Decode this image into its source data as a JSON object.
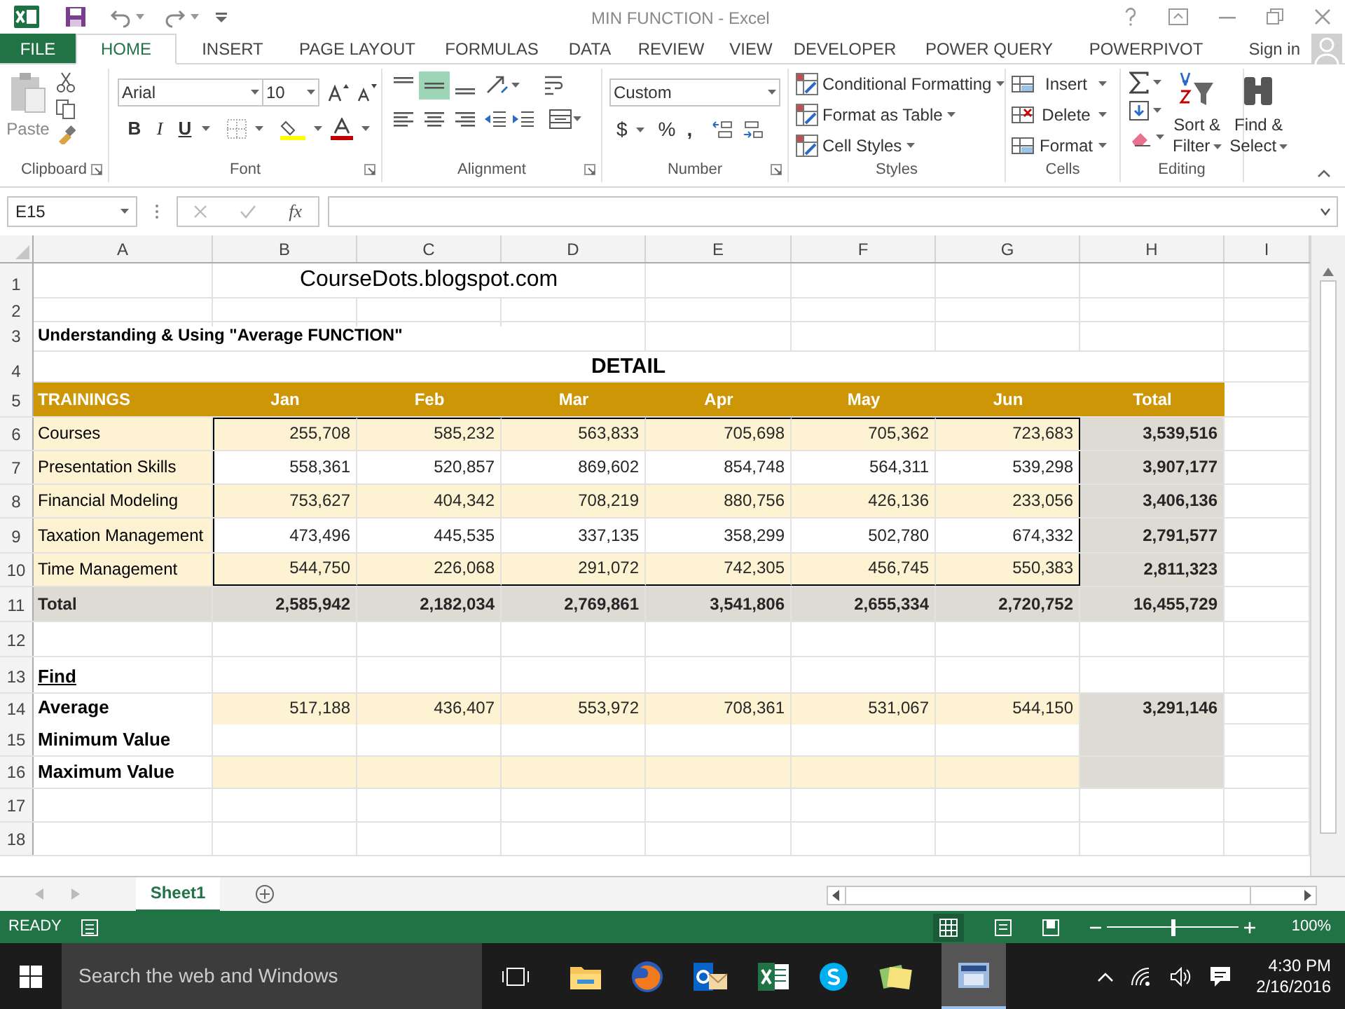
{
  "title_bar": {
    "title": "MIN FUNCTION - Excel"
  },
  "ribbon_tabs": [
    {
      "label": "FILE",
      "kind": "file",
      "selected": false
    },
    {
      "label": "HOME",
      "kind": "tab",
      "selected": true
    },
    {
      "label": "INSERT",
      "kind": "tab",
      "selected": false
    },
    {
      "label": "PAGE LAYOUT",
      "kind": "tab",
      "selected": false
    },
    {
      "label": "FORMULAS",
      "kind": "tab",
      "selected": false
    },
    {
      "label": "DATA",
      "kind": "tab",
      "selected": false
    },
    {
      "label": "REVIEW",
      "kind": "tab",
      "selected": false
    },
    {
      "label": "VIEW",
      "kind": "tab",
      "selected": false
    },
    {
      "label": "DEVELOPER",
      "kind": "tab",
      "selected": false
    },
    {
      "label": "POWER QUERY",
      "kind": "tab",
      "selected": false
    },
    {
      "label": "POWERPIVOT",
      "kind": "tab",
      "selected": false
    }
  ],
  "sign_in": "Sign in",
  "ribbon": {
    "paste": "Paste",
    "font_name": "Arial",
    "font_size": "10",
    "bold": "B",
    "italic": "I",
    "underline": "U",
    "number_format": "Custom",
    "currency": "$",
    "percent": "%",
    "comma": ",",
    "styles_items": [
      "Conditional Formatting",
      "Format as Table",
      "Cell Styles"
    ],
    "cells_items": [
      "Insert",
      "Delete",
      "Format"
    ],
    "sort_filter": [
      "Sort &",
      "Filter"
    ],
    "find_select": [
      "Find &",
      "Select"
    ],
    "groups": [
      "Clipboard",
      "Font",
      "Alignment",
      "Number",
      "Styles",
      "Cells",
      "Editing"
    ]
  },
  "formula_bar": {
    "name_box": "E15",
    "fx": "fx"
  },
  "columns": [
    "A",
    "B",
    "C",
    "D",
    "E",
    "F",
    "G",
    "H",
    "I"
  ],
  "rows": [
    {
      "number": "1",
      "kind": "site",
      "text": "CourseDots.blogspot.com"
    },
    {
      "number": "2",
      "kind": "blank"
    },
    {
      "number": "3",
      "kind": "heading",
      "label": "Understanding & Using \"Average FUNCTION\""
    },
    {
      "number": "4",
      "kind": "detail",
      "title": "DETAIL"
    },
    {
      "number": "5",
      "kind": "header",
      "label": "TRAININGS",
      "values": [
        "Jan",
        "Feb",
        "Mar",
        "Apr",
        "May",
        "Jun"
      ],
      "total": "Total"
    },
    {
      "number": "6",
      "kind": "data",
      "banded": true,
      "label": "Courses",
      "values": [
        "255,708",
        "585,232",
        "563,833",
        "705,698",
        "705,362",
        "723,683"
      ],
      "total": "3,539,516"
    },
    {
      "number": "7",
      "kind": "data",
      "banded": false,
      "label": "Presentation Skills",
      "values": [
        "558,361",
        "520,857",
        "869,602",
        "854,748",
        "564,311",
        "539,298"
      ],
      "total": "3,907,177"
    },
    {
      "number": "8",
      "kind": "data",
      "banded": true,
      "label": "Financial Modeling",
      "values": [
        "753,627",
        "404,342",
        "708,219",
        "880,756",
        "426,136",
        "233,056"
      ],
      "total": "3,406,136"
    },
    {
      "number": "9",
      "kind": "data",
      "banded": false,
      "label": "Taxation Management",
      "values": [
        "473,496",
        "445,535",
        "337,135",
        "358,299",
        "502,780",
        "674,332"
      ],
      "total": "2,791,577"
    },
    {
      "number": "10",
      "kind": "data",
      "banded": true,
      "label": "Time Management",
      "values": [
        "544,750",
        "226,068",
        "291,072",
        "742,305",
        "456,745",
        "550,383"
      ],
      "total": "2,811,323"
    },
    {
      "number": "11",
      "kind": "total",
      "label": "Total",
      "values": [
        "2,585,942",
        "2,182,034",
        "2,769,861",
        "3,541,806",
        "2,655,334",
        "2,720,752"
      ],
      "total": "16,455,729"
    },
    {
      "number": "12",
      "kind": "blank"
    },
    {
      "number": "13",
      "kind": "find",
      "label": "Find"
    },
    {
      "number": "14",
      "kind": "summary",
      "banded": true,
      "label": "Average",
      "values": [
        "517,188",
        "436,407",
        "553,972",
        "708,361",
        "531,067",
        "544,150"
      ],
      "total": "3,291,146"
    },
    {
      "number": "15",
      "kind": "summary",
      "banded": false,
      "label": "Minimum Value"
    },
    {
      "number": "16",
      "kind": "summary",
      "banded": true,
      "label": "Maximum Value"
    },
    {
      "number": "17",
      "kind": "blank"
    },
    {
      "number": "18",
      "kind": "blank"
    }
  ],
  "sheet_tabs": [
    {
      "label": "Sheet1",
      "selected": true
    }
  ],
  "status_bar": {
    "mode": "READY",
    "zoom_slider": {
      "level": 0.5
    },
    "zoom": "100%"
  },
  "taskbar": {
    "search": "Search the web and Windows",
    "time": "4:30 PM",
    "date": "2/16/2016"
  }
}
